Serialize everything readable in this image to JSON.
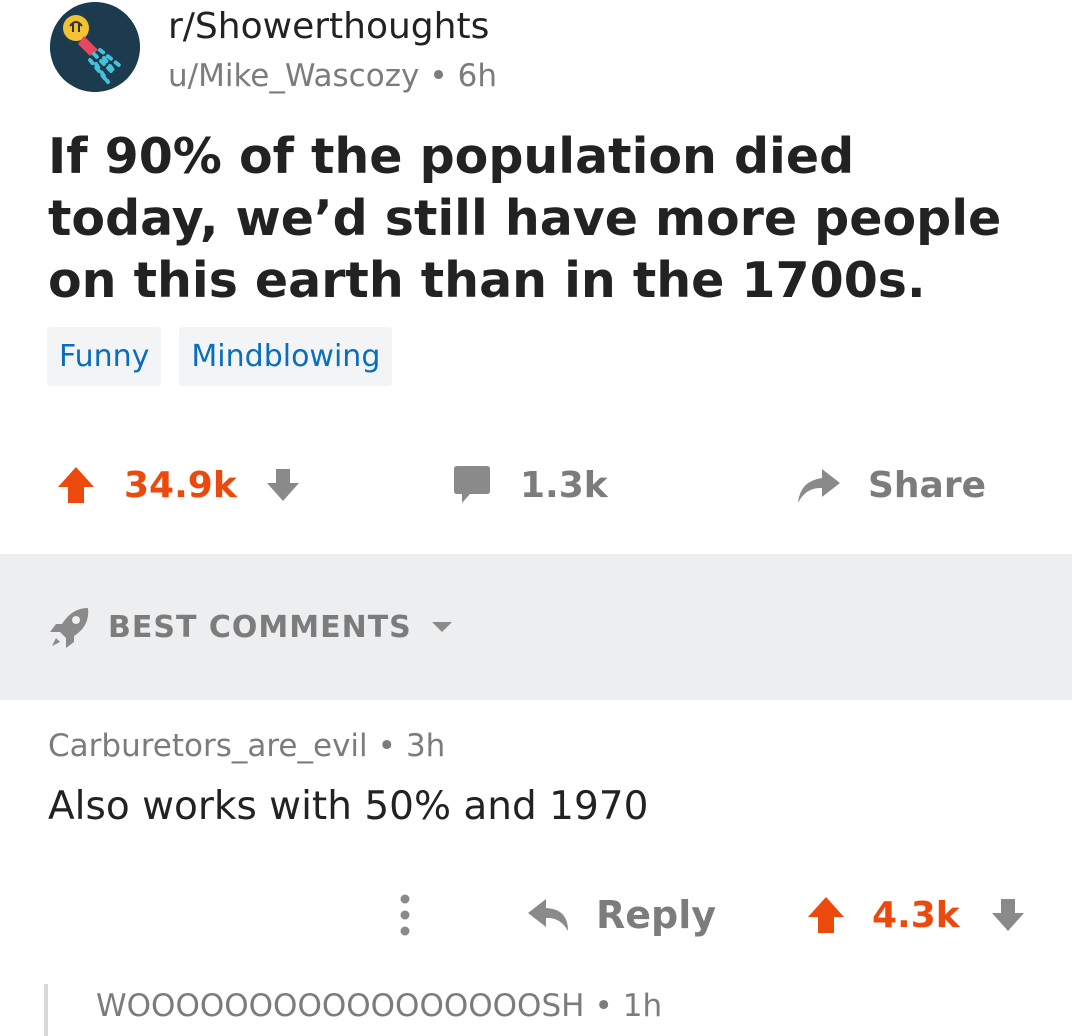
{
  "post": {
    "subreddit": "r/Showerthoughts",
    "author": "u/Mike_Wascozy",
    "separator": "•",
    "age": "6h",
    "title": "If 90% of the population died today, we’d still have more people on this earth than in the 1700s.",
    "flairs": [
      "Funny",
      "Mindblowing"
    ],
    "score": "34.9k",
    "comments": "1.3k",
    "share_label": "Share"
  },
  "sort": {
    "label": "BEST COMMENTS"
  },
  "comment": {
    "author": "Carburetors_are_evil",
    "separator": "•",
    "age": "3h",
    "body": "Also works with 50% and 1970",
    "reply_label": "Reply",
    "score": "4.3k"
  },
  "reply": {
    "author": "WOOOOOOOOOOOOOOOOOSH",
    "separator": "•",
    "age": "1h"
  },
  "colors": {
    "upvote": "#ec4a0d",
    "muted": "#7c7c7c",
    "flair_text": "#0a6ebd",
    "band": "#edeef0"
  }
}
